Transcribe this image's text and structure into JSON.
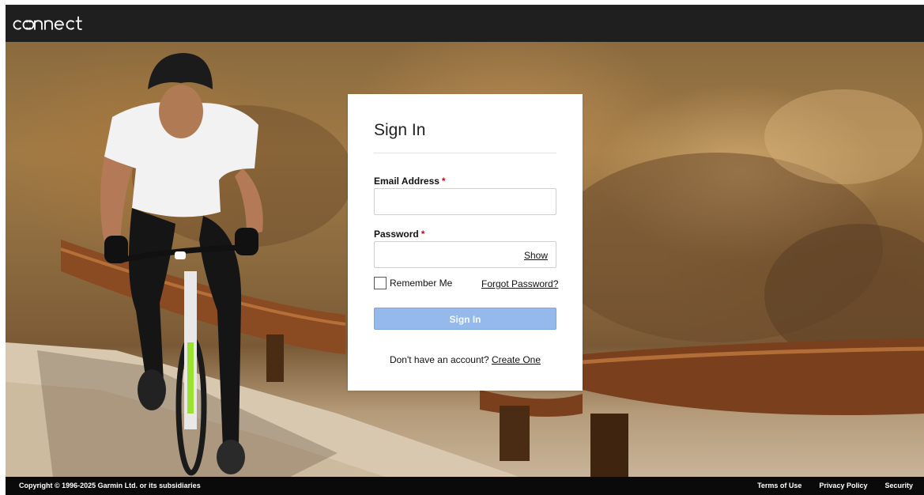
{
  "header": {
    "logo_text": "connect"
  },
  "signin": {
    "title": "Sign In",
    "email_label": "Email Address",
    "email_value": "",
    "password_label": "Password",
    "password_value": "",
    "required_mark": "*",
    "show_label": "Show",
    "remember_label": "Remember Me",
    "remember_checked": false,
    "forgot_label": "Forgot Password?",
    "button_label": "Sign In",
    "no_account_text": "Don't have an account?",
    "create_label": "Create One"
  },
  "footer": {
    "copyright": "Copyright © 1996-2025 Garmin Ltd. or its subsidiaries",
    "links": [
      "Terms of Use",
      "Privacy Policy",
      "Security"
    ]
  },
  "colors": {
    "header_bg": "#1f1f1f",
    "button_bg": "#94b9ea",
    "required": "#d0021b",
    "footer_bg": "#0a0a0a"
  }
}
